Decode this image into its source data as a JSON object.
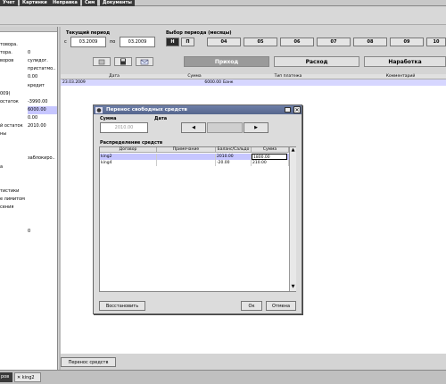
{
  "menu": {
    "items": [
      "Учет",
      "Картинки",
      "Неправка",
      "Сим",
      "Документы"
    ]
  },
  "left_panel": {
    "rows": [
      {
        "k": "товора.",
        "v": ""
      },
      {
        "k": "тора.",
        "v": "0"
      },
      {
        "k": "воров",
        "v": "сулидог."
      },
      {
        "k": "",
        "v": "пристатмо.."
      },
      {
        "k": "",
        "v": "0.00"
      },
      {
        "k": "",
        "v": "кредит"
      },
      {
        "k": "009)",
        "v": ""
      },
      {
        "k": "остаток",
        "v": "-3990.00"
      },
      {
        "k": "",
        "v": "6000.00"
      },
      {
        "k": "",
        "v": "0.00"
      },
      {
        "k": "й остаток",
        "v": "2010.00"
      },
      {
        "k": "ны",
        "v": ""
      },
      {
        "k": "",
        "v": ""
      },
      {
        "k": "",
        "v": ""
      },
      {
        "k": "",
        "v": "заблокиро.."
      },
      {
        "k": "а",
        "v": ""
      },
      {
        "k": "",
        "v": ""
      },
      {
        "k": "",
        "v": ""
      },
      {
        "k": "тистики",
        "v": ""
      },
      {
        "k": "е лимитом",
        "v": ""
      },
      {
        "k": "сения",
        "v": ""
      },
      {
        "k": "",
        "v": ""
      },
      {
        "k": "",
        "v": ""
      },
      {
        "k": "",
        "v": "0"
      }
    ]
  },
  "period": {
    "label": "Текущий период",
    "from_prefix": "с",
    "from": "03.2009",
    "to_prefix": "по",
    "to": "03.2009"
  },
  "period_select": {
    "label": "Выбор периода (месяцы)",
    "mode_buttons": [
      "Н",
      "П"
    ],
    "months": [
      "04",
      "05",
      "06",
      "07",
      "08",
      "09",
      "10"
    ]
  },
  "tabs": [
    "Приход",
    "Расход",
    "Наработка"
  ],
  "grid": {
    "headers": [
      "Дата",
      "Сумма",
      "Тип платежа",
      "Комментарий"
    ],
    "rows": [
      {
        "date": "23.03.2009",
        "sum": "6000.00",
        "type": "Банк",
        "comment": ""
      }
    ]
  },
  "bottom": {
    "transfer_button": "Перенос средств"
  },
  "taskbar": {
    "left_label": "ров",
    "tab_label": "king2"
  },
  "dialog": {
    "title": "Перенос свободных средств",
    "sum_label": "Сумма",
    "sum_value": "2010.00",
    "date_label": "Дата",
    "distribution_label": "Распределение средств",
    "table_headers": [
      "Договор",
      "Примечание",
      "Баланс/Сальдо",
      "Сумма"
    ],
    "table_rows": [
      {
        "contract": "king2",
        "note": "",
        "balance": "2010.00",
        "sum": "1800.00"
      },
      {
        "contract": "king4",
        "note": "",
        "balance": "-20.00",
        "sum": "210.00"
      }
    ],
    "restore_button": "Восстановить",
    "ok_button": "Ок",
    "cancel_button": "Отмена"
  },
  "colors": {
    "selection": "#c6c6ff",
    "dialog_title": "#5d6e98",
    "active_tab": "#9a9a9a"
  }
}
